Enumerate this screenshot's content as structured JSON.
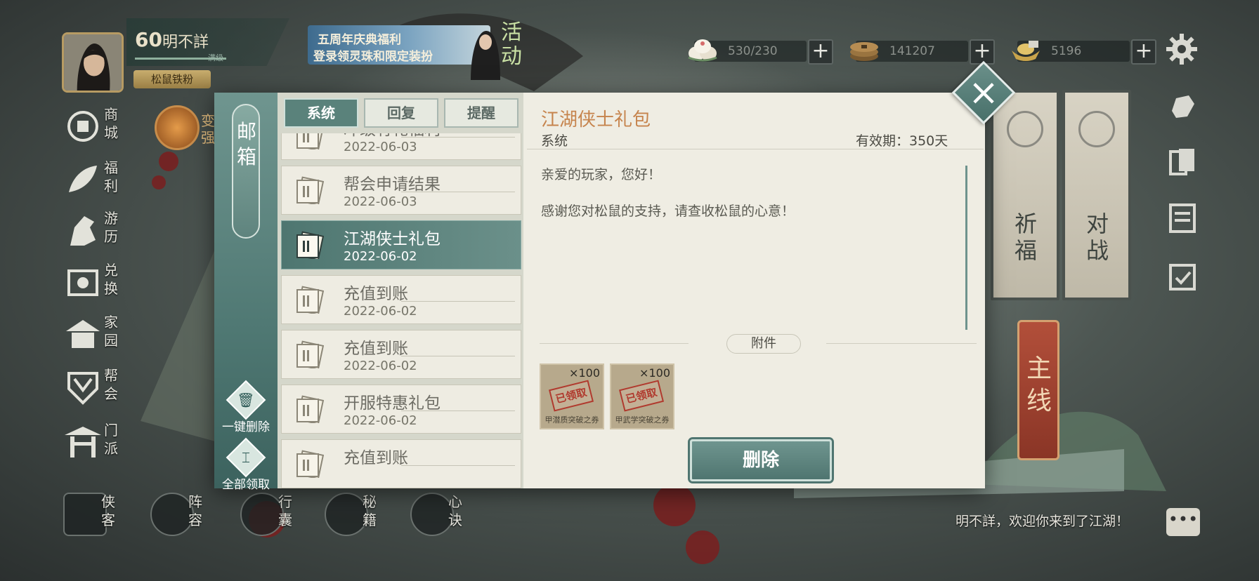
{
  "player": {
    "level": "60",
    "name": "明不詳",
    "exp_label": "满级",
    "title_badge": "松鼠铁粉"
  },
  "event_banner": {
    "line1": "五周年庆典福利",
    "line2": "登录领灵珠和限定装扮",
    "tag": "活动"
  },
  "currencies": [
    {
      "icon": "stamina-buns-icon",
      "value": "530/230"
    },
    {
      "icon": "copper-coins-icon",
      "value": "141207"
    },
    {
      "icon": "gold-ingot-icon",
      "value": "5196"
    }
  ],
  "left_nav": [
    {
      "label": "商城",
      "icon": "shop-coin-icon"
    },
    {
      "label": "福利",
      "icon": "gift-flower-icon"
    },
    {
      "label": "游历",
      "icon": "horse-icon"
    },
    {
      "label": "兑换",
      "icon": "exchange-icon"
    },
    {
      "label": "家园",
      "icon": "home-pavilion-icon"
    },
    {
      "label": "帮会",
      "icon": "guild-shield-icon"
    },
    {
      "label": "门派",
      "icon": "sect-gate-icon"
    }
  ],
  "partial_tile": {
    "line1": "变",
    "line2": "强"
  },
  "scrolls": [
    {
      "label": "祈福"
    },
    {
      "label": "对战"
    }
  ],
  "main_quest": {
    "label": "主线"
  },
  "bottom_nav": [
    {
      "label": "侠客",
      "icon": "hero-icon"
    },
    {
      "label": "阵容",
      "icon": "formation-icon"
    },
    {
      "label": "行囊",
      "icon": "bag-icon"
    },
    {
      "label": "秘籍",
      "icon": "book-icon"
    },
    {
      "label": "心诀",
      "icon": "flame-icon"
    }
  ],
  "welcome_message": "明不詳，欢迎你来到了江湖！",
  "mailbox": {
    "title": "邮箱",
    "tabs": [
      "系统",
      "回复",
      "提醒"
    ],
    "active_tab": 0,
    "delete_all_label": "一键删除",
    "claim_all_label": "全部领取",
    "mails": [
      {
        "title": "冲级有礼福利",
        "date": "2022-06-03",
        "selected": false
      },
      {
        "title": "帮会申请结果",
        "date": "2022-06-03",
        "selected": false
      },
      {
        "title": "江湖侠士礼包",
        "date": "2022-06-02",
        "selected": true
      },
      {
        "title": "充值到账",
        "date": "2022-06-02",
        "selected": false
      },
      {
        "title": "充值到账",
        "date": "2022-06-02",
        "selected": false
      },
      {
        "title": "开服特惠礼包",
        "date": "2022-06-02",
        "selected": false
      },
      {
        "title": "充值到账",
        "date": "",
        "selected": false
      }
    ],
    "detail": {
      "title": "江湖侠士礼包",
      "sender": "系统",
      "validity": "有效期：350天",
      "greeting": "亲爱的玩家，您好！",
      "body": "感谢您对松鼠的支持，请查收松鼠的心意！",
      "attachments_label": "附件",
      "attachments": [
        {
          "qty": "×100",
          "stamp": "已领取",
          "name": "甲潜质突破之券"
        },
        {
          "qty": "×100",
          "stamp": "已领取",
          "name": "甲武学突破之券"
        }
      ],
      "delete_label": "删除"
    }
  },
  "colors": {
    "accent_teal": "#5a827b",
    "title_orange": "#c6844d",
    "panel_bg": "#efede3",
    "stamp_red": "#b03a2e"
  }
}
